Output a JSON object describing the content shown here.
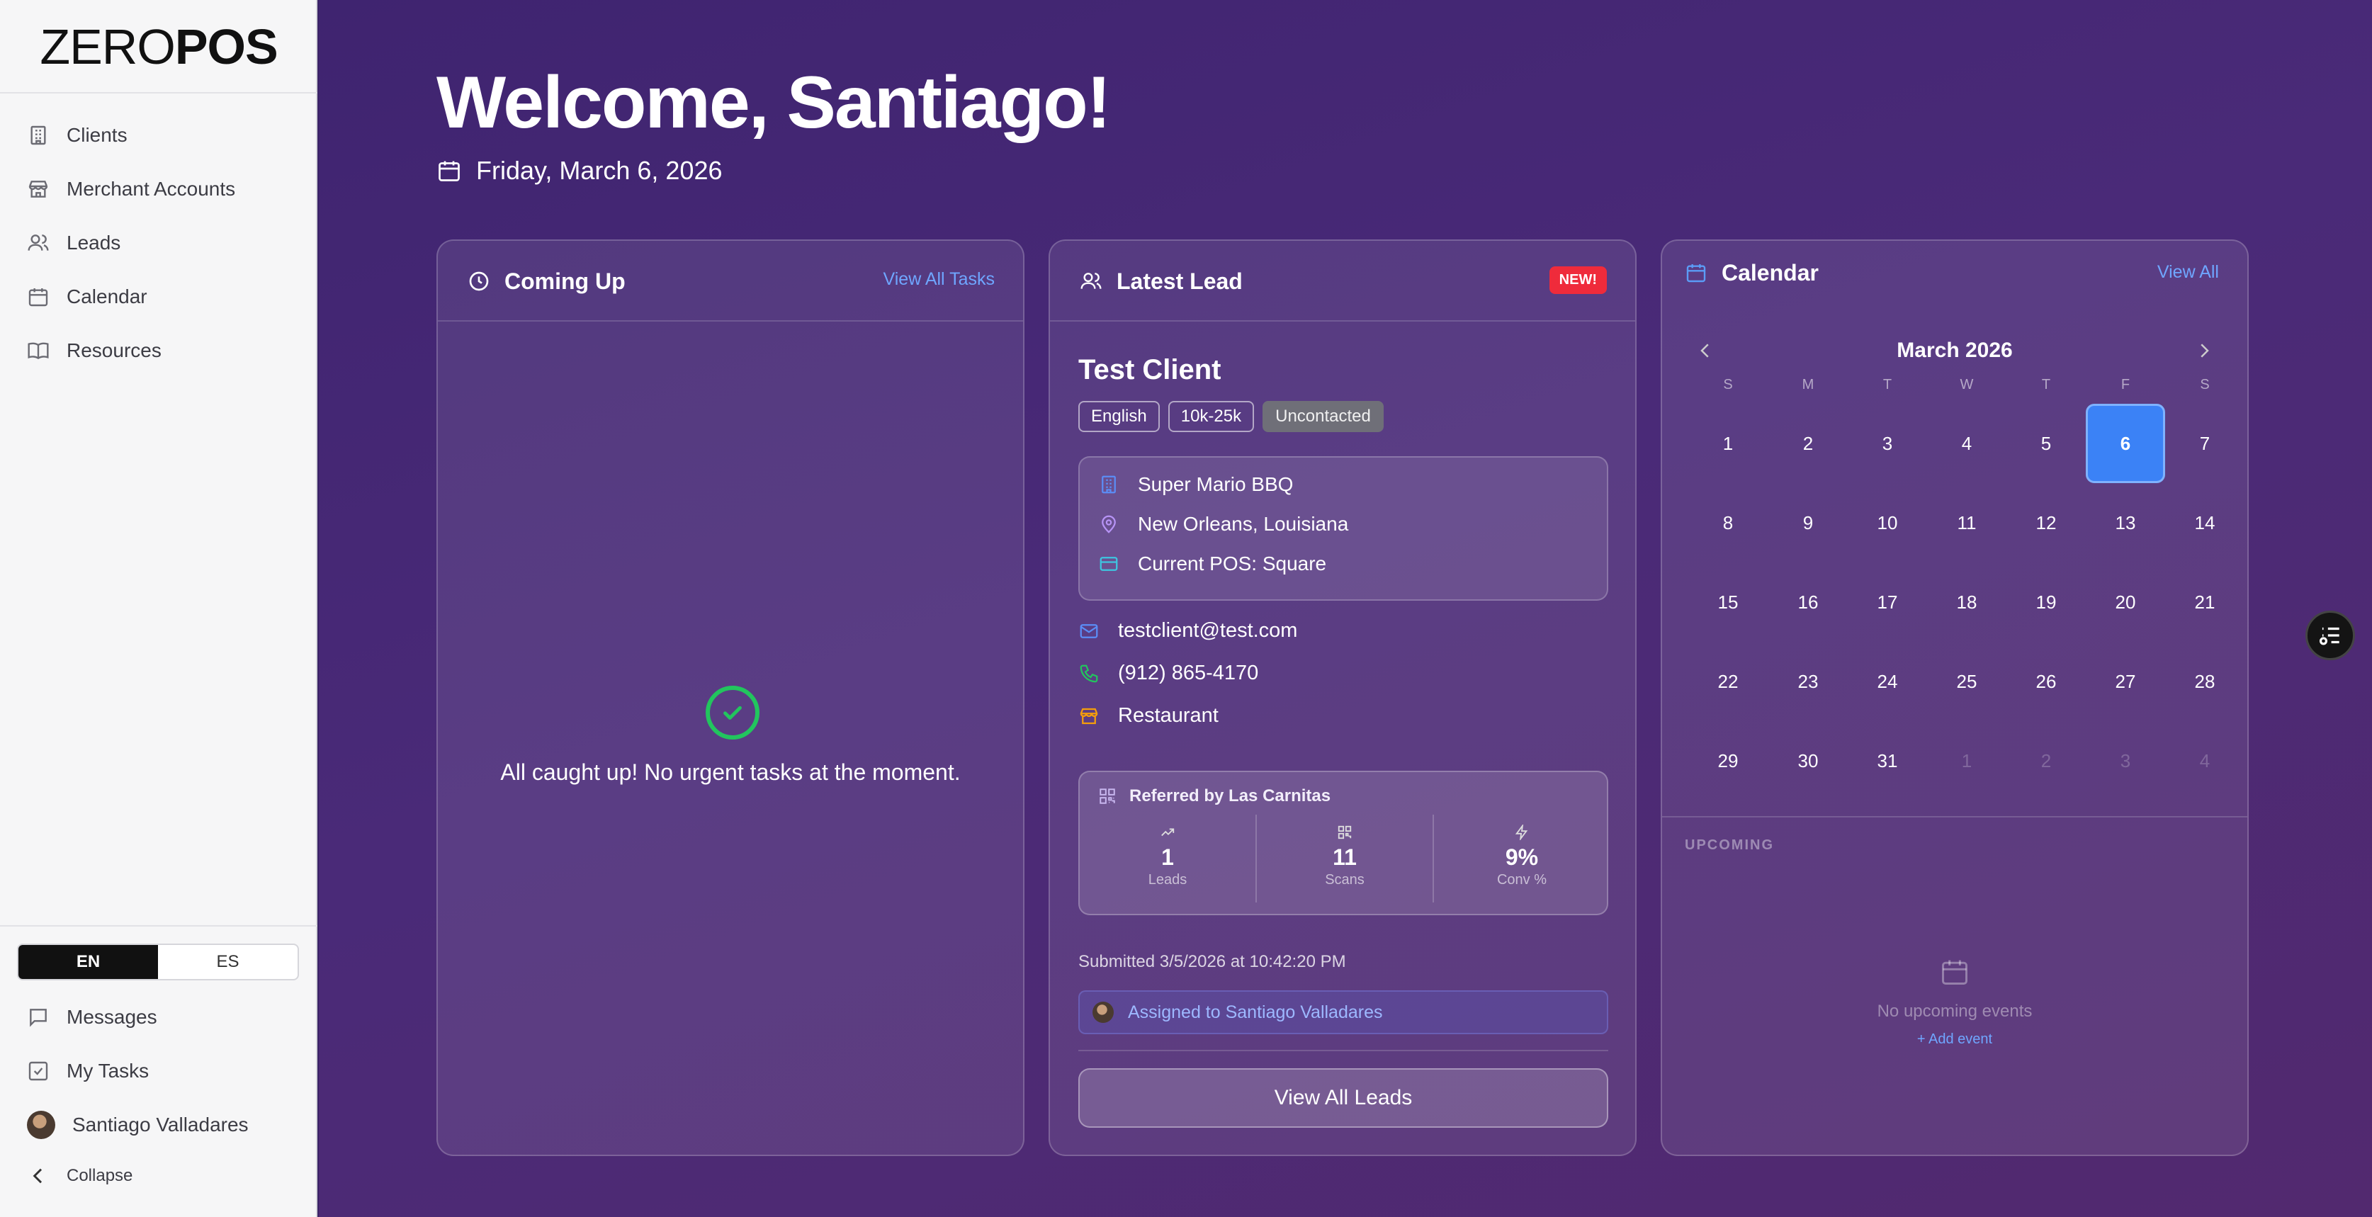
{
  "brand": {
    "logo_light": "ZERO",
    "logo_bold": "POS"
  },
  "sidebar": {
    "items": [
      {
        "label": "Clients",
        "icon": "building-icon"
      },
      {
        "label": "Merchant Accounts",
        "icon": "store-icon"
      },
      {
        "label": "Leads",
        "icon": "users-icon"
      },
      {
        "label": "Calendar",
        "icon": "calendar-icon"
      },
      {
        "label": "Resources",
        "icon": "book-icon"
      }
    ],
    "lang_en": "EN",
    "lang_es": "ES",
    "lang_selected": "EN",
    "bottom": {
      "messages": "Messages",
      "tasks": "My Tasks",
      "user": "Santiago Valladares",
      "collapse": "Collapse"
    }
  },
  "header": {
    "welcome": "Welcome, Santiago!",
    "date": "Friday, March 6, 2026"
  },
  "coming_up": {
    "title": "Coming Up",
    "link": "View All Tasks",
    "empty_message": "All caught up! No urgent tasks at the moment."
  },
  "latest_lead": {
    "title": "Latest Lead",
    "badge": "NEW!",
    "name": "Test Client",
    "tags": [
      "English",
      "10k-25k",
      "Uncontacted"
    ],
    "business": "Super Mario BBQ",
    "location": "New Orleans, Louisiana",
    "pos": "Current POS: Square",
    "email": "testclient@test.com",
    "phone": "(912) 865-4170",
    "category": "Restaurant",
    "referral": {
      "title": "Referred by Las Carnitas",
      "stats": [
        {
          "value": "1",
          "label": "Leads"
        },
        {
          "value": "11",
          "label": "Scans"
        },
        {
          "value": "9%",
          "label": "Conv %"
        }
      ]
    },
    "submitted": "Submitted 3/5/2026 at 10:42:20 PM",
    "assigned": "Assigned to Santiago Valladares",
    "view_all": "View All Leads"
  },
  "calendar": {
    "title": "Calendar",
    "link": "View All",
    "month": "March 2026",
    "weekdays": [
      "S",
      "M",
      "T",
      "W",
      "T",
      "F",
      "S"
    ],
    "days": [
      "1",
      "2",
      "3",
      "4",
      "5",
      "6",
      "7",
      "8",
      "9",
      "10",
      "11",
      "12",
      "13",
      "14",
      "15",
      "16",
      "17",
      "18",
      "19",
      "20",
      "21",
      "22",
      "23",
      "24",
      "25",
      "26",
      "27",
      "28",
      "29",
      "30",
      "31",
      "1",
      "2",
      "3",
      "4"
    ],
    "selected_day": "6",
    "upcoming_label": "UPCOMING",
    "no_events": "No upcoming events",
    "add_event": "+ Add event"
  },
  "colors": {
    "accent": "#3b82f6",
    "link": "#6fa6ff",
    "badge": "#ef2b3b",
    "success": "#22c55e",
    "background": "#3f2470"
  }
}
